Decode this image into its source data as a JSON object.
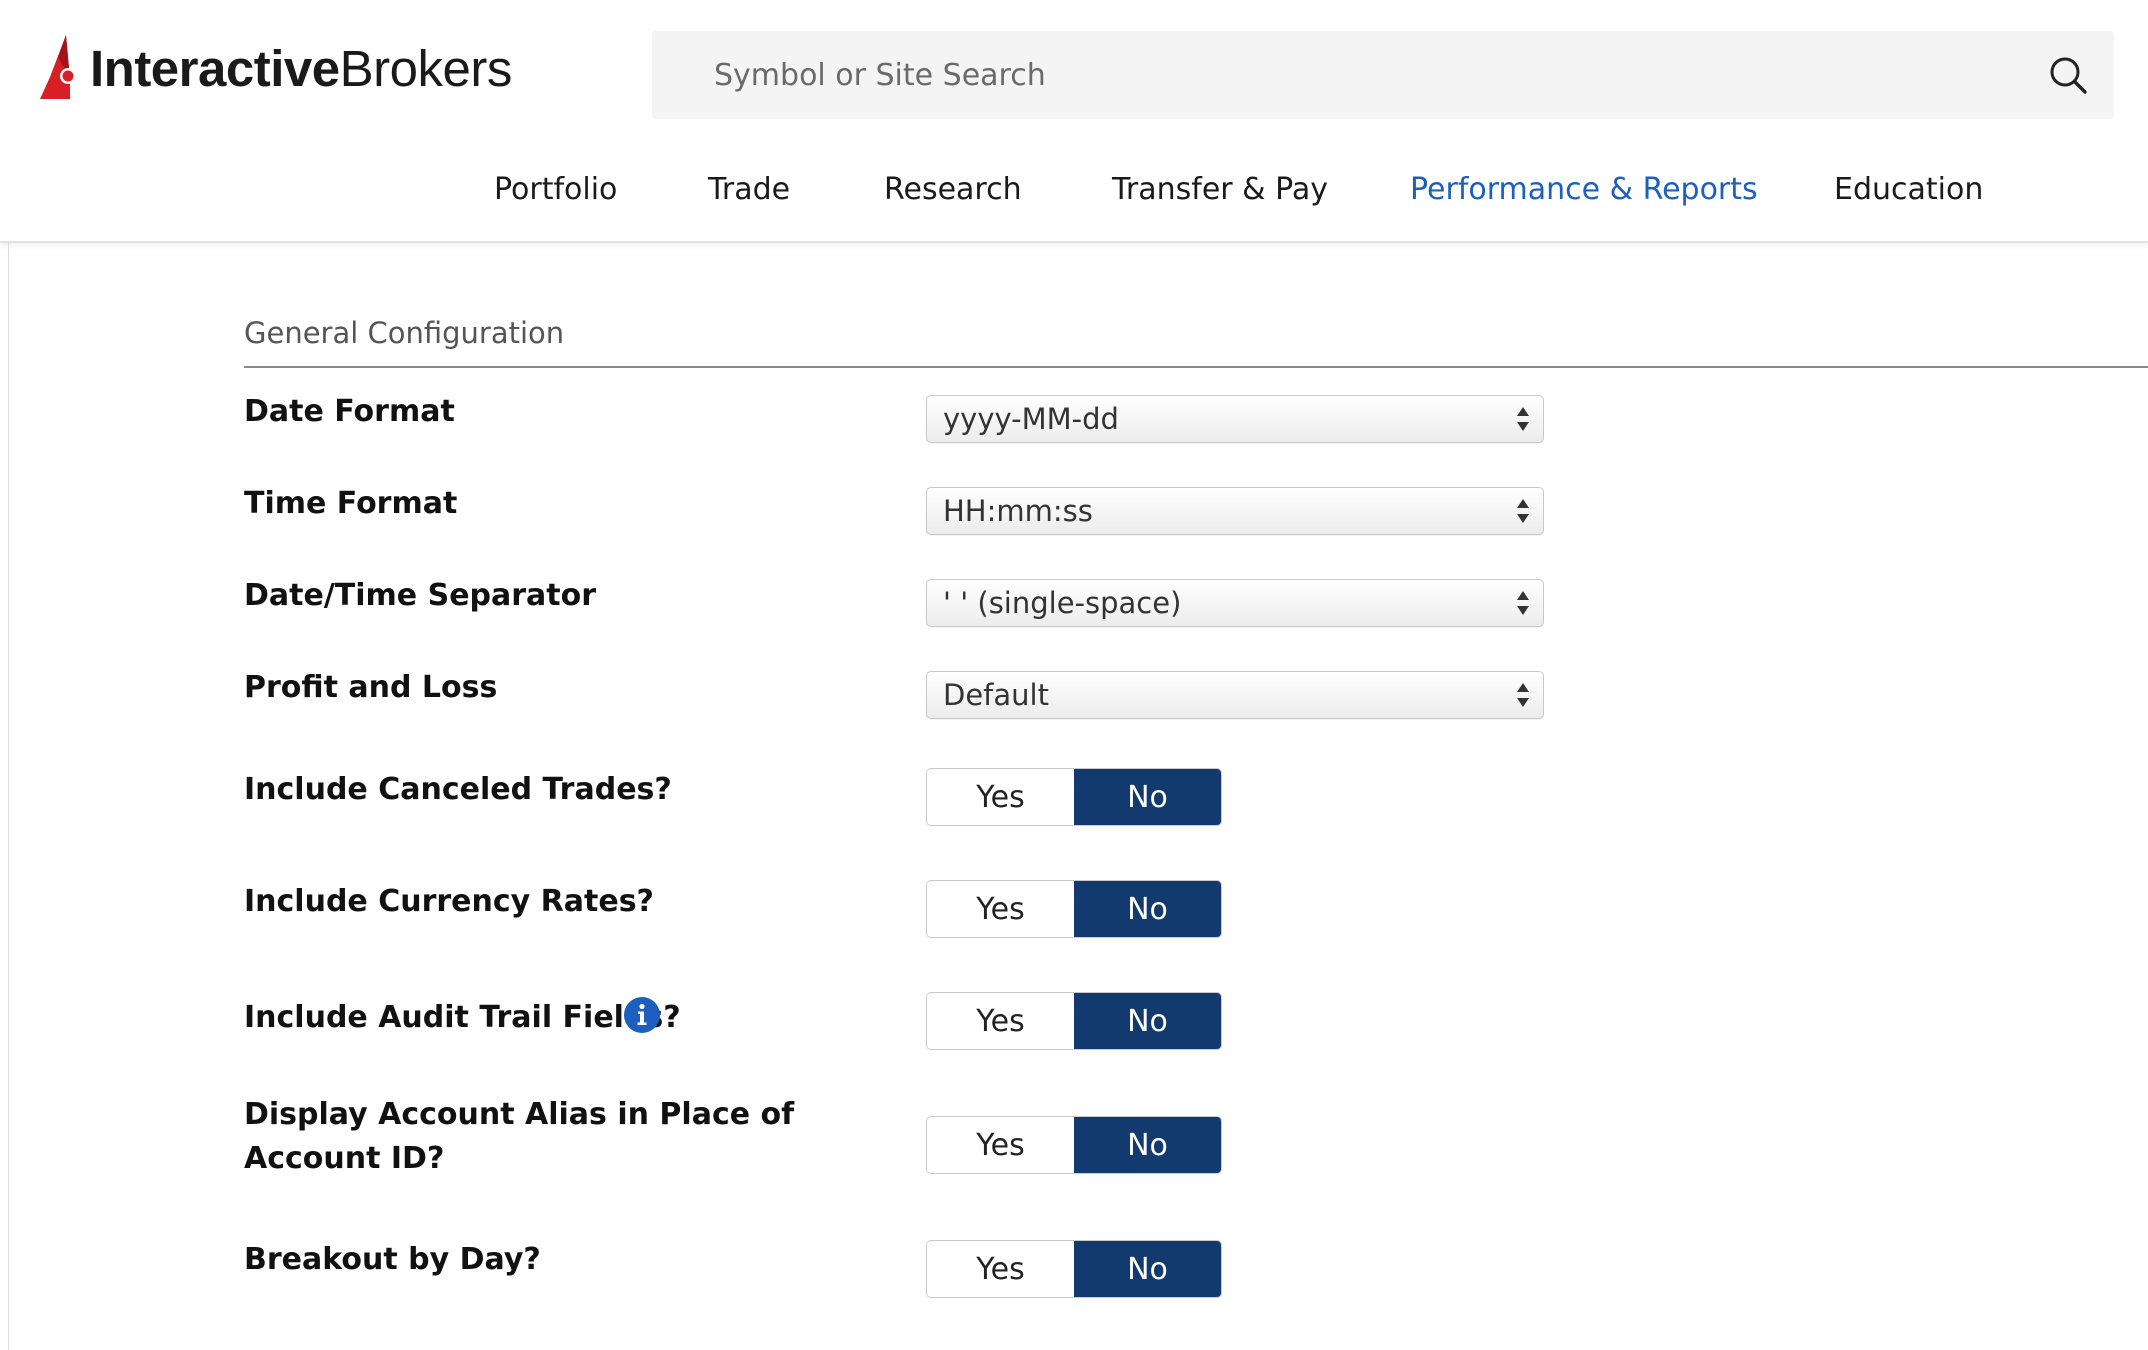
{
  "header": {
    "logo": {
      "bold_text": "Interactive",
      "light_text": "Brokers",
      "brand_color": "#d81f26"
    },
    "search": {
      "placeholder": "Symbol or Site Search",
      "icon": "search-icon"
    },
    "nav": {
      "items": [
        {
          "label": "Portfolio",
          "active": false
        },
        {
          "label": "Trade",
          "active": false
        },
        {
          "label": "Research",
          "active": false
        },
        {
          "label": "Transfer & Pay",
          "active": false
        },
        {
          "label": "Performance & Reports",
          "active": true
        },
        {
          "label": "Education",
          "active": false
        }
      ],
      "active_color": "#1d5fbf"
    }
  },
  "main": {
    "section_title": "General Configuration",
    "selects": [
      {
        "label": "Date Format",
        "value": "yyyy-MM-dd"
      },
      {
        "label": "Time Format",
        "value": "HH:mm:ss"
      },
      {
        "label": "Date/Time Separator",
        "value": "' ' (single-space)"
      },
      {
        "label": "Profit and Loss",
        "value": "Default"
      }
    ],
    "toggles": [
      {
        "label": "Include Canceled Trades?",
        "yes": "Yes",
        "no": "No",
        "selected": "No"
      },
      {
        "label": "Include Currency Rates?",
        "yes": "Yes",
        "no": "No",
        "selected": "No"
      },
      {
        "label": "Include Audit Trail Fields?",
        "yes": "Yes",
        "no": "No",
        "selected": "No",
        "info_icon": "info-icon"
      },
      {
        "label": "Display Account Alias in Place of Account ID?",
        "yes": "Yes",
        "no": "No",
        "selected": "No"
      },
      {
        "label": "Breakout by Day?",
        "yes": "Yes",
        "no": "No",
        "selected": "No"
      }
    ],
    "selected_toggle_color": "#123a6e",
    "info_icon_color": "#1d5fbf"
  }
}
